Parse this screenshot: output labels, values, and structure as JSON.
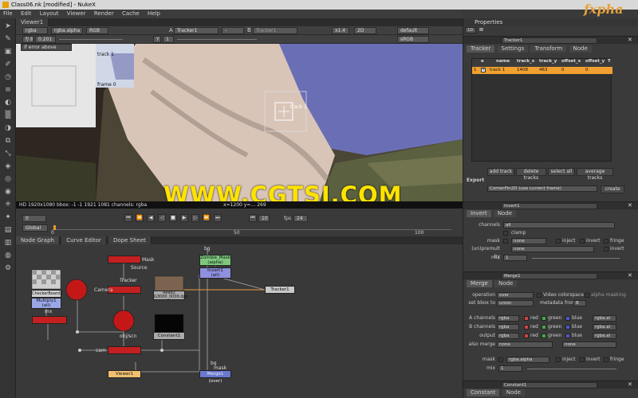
{
  "window": {
    "title": "Class06.nk [modified] - NukeX"
  },
  "menu": [
    "File",
    "Edit",
    "Layout",
    "Viewer",
    "Render",
    "Cache",
    "Help"
  ],
  "viewer": {
    "tab": "Viewer1",
    "channels": "rgba",
    "layer": "rgba.alpha",
    "colorspace": "RGB",
    "gain": "f/ 8",
    "gain_val": "0.201",
    "input_a_label": "A",
    "input_a": "Tracker1",
    "input_b_label": "B",
    "input_b": "Tracker1",
    "zoom": "x1.4",
    "view": "2D",
    "lut": "default",
    "display": "sRGB",
    "gamma": "Y",
    "gamma_val": "1",
    "roi": "if error above",
    "status": "HD 1920x1080  bbox: -1 -1 1921 1081  channels: rgba",
    "track_label": "track 1",
    "inset_label": "track 1",
    "inset_frame": "frame 0",
    "color_info": "x=1200 y=…  269"
  },
  "watermark": "WWW.CGTSJ.COM",
  "logo": "fxpha",
  "timeline": {
    "frame": "0",
    "fps_label": "fps",
    "fps": "24",
    "frame2": "10",
    "global": "Global",
    "ticks": [
      "0",
      "50",
      "100"
    ]
  },
  "nodegraph": {
    "tabs": [
      "Node Graph",
      "Curve Editor",
      "Dope Sheet"
    ],
    "nodes": {
      "checkerboard": "CheckerBoard1",
      "multiply": "Multiply1\n(all)",
      "zombie": "Zombie_Mask\n(alpha)",
      "invert": "Invert1\n(all)",
      "read": "Read2\nG3000_0000.dpx",
      "tracker": "Tracker1",
      "constant": "Constant1",
      "viewer": "Viewer1",
      "merge": "Merge1 (over)"
    },
    "labels": {
      "bg": "bg",
      "mask": "Mask",
      "source": "Source",
      "tracker_lbl": "Tracker",
      "camera": "Camera",
      "mask2": "mask",
      "cam": "cam",
      "obj": "obj/scn",
      "bg2": "bg",
      "mask3": "mask"
    }
  },
  "properties": {
    "title": "Properties",
    "count": "10",
    "tracker": {
      "name": "Tracker1",
      "tabs": [
        "Tracker",
        "Settings",
        "Transform",
        "Node"
      ],
      "columns": [
        "e",
        "name",
        "track_x",
        "track_y",
        "offset_x",
        "offset_y",
        "T"
      ],
      "rows": [
        {
          "idx": "1",
          "name": "track 1",
          "track_x": "1408",
          "track_y": "463",
          "offset_x": "0",
          "offset_y": "0"
        }
      ],
      "buttons": [
        "add track",
        "delete tracks",
        "select all",
        "average tracks"
      ],
      "export_label": "Export",
      "export_value": "CornerPin2D (use current frame)",
      "create": "create"
    },
    "invert": {
      "name": "Invert1",
      "tabs": [
        "Invert",
        "Node"
      ],
      "channels_label": "channels",
      "channels": "all",
      "clamp": "clamp",
      "mask_label": "mask",
      "mask": "none",
      "inject": "inject",
      "invert": "invert",
      "fringe": "fringe",
      "unpremult_label": "(un)premult by",
      "unpremult": "none",
      "invert2": "invert",
      "mix_label": "mix",
      "mix": "1"
    },
    "merge": {
      "name": "Merge1",
      "tabs": [
        "Merge",
        "Node"
      ],
      "operation_label": "operation",
      "operation": "over",
      "video_cs": "Video colorspace",
      "alpha_masking": "alpha masking",
      "bbox_label": "set bbox to",
      "bbox": "union",
      "metadata_label": "metadata from",
      "metadata": "B",
      "a_label": "A channels",
      "a": "rgba",
      "b_label": "B channels",
      "b": "rgba",
      "output_label": "output",
      "output": "rgba",
      "also_label": "also merge",
      "also": "none",
      "also2": "none",
      "red": "red",
      "green": "green",
      "blue": "blue",
      "rgba_alpha": "rgba.al",
      "mask_label": "mask",
      "mask": "rgba.alpha",
      "inject": "inject",
      "invert": "invert",
      "fringe": "fringe",
      "mix_label": "mix",
      "mix": "1"
    },
    "constant": {
      "name": "Constant1",
      "tabs": [
        "Constant",
        "Node"
      ]
    },
    "slider_ticks": [
      "0",
      "0.1",
      "0.2",
      "0.3",
      "0.4",
      "0.5",
      "0.6",
      "0.7",
      "0.8",
      "0.9",
      "1"
    ]
  },
  "colors": {
    "accent": "#f0a030",
    "node_red": "#cc1c1c",
    "node_purple": "#8e8ee0",
    "node_green": "#7ec87e"
  }
}
